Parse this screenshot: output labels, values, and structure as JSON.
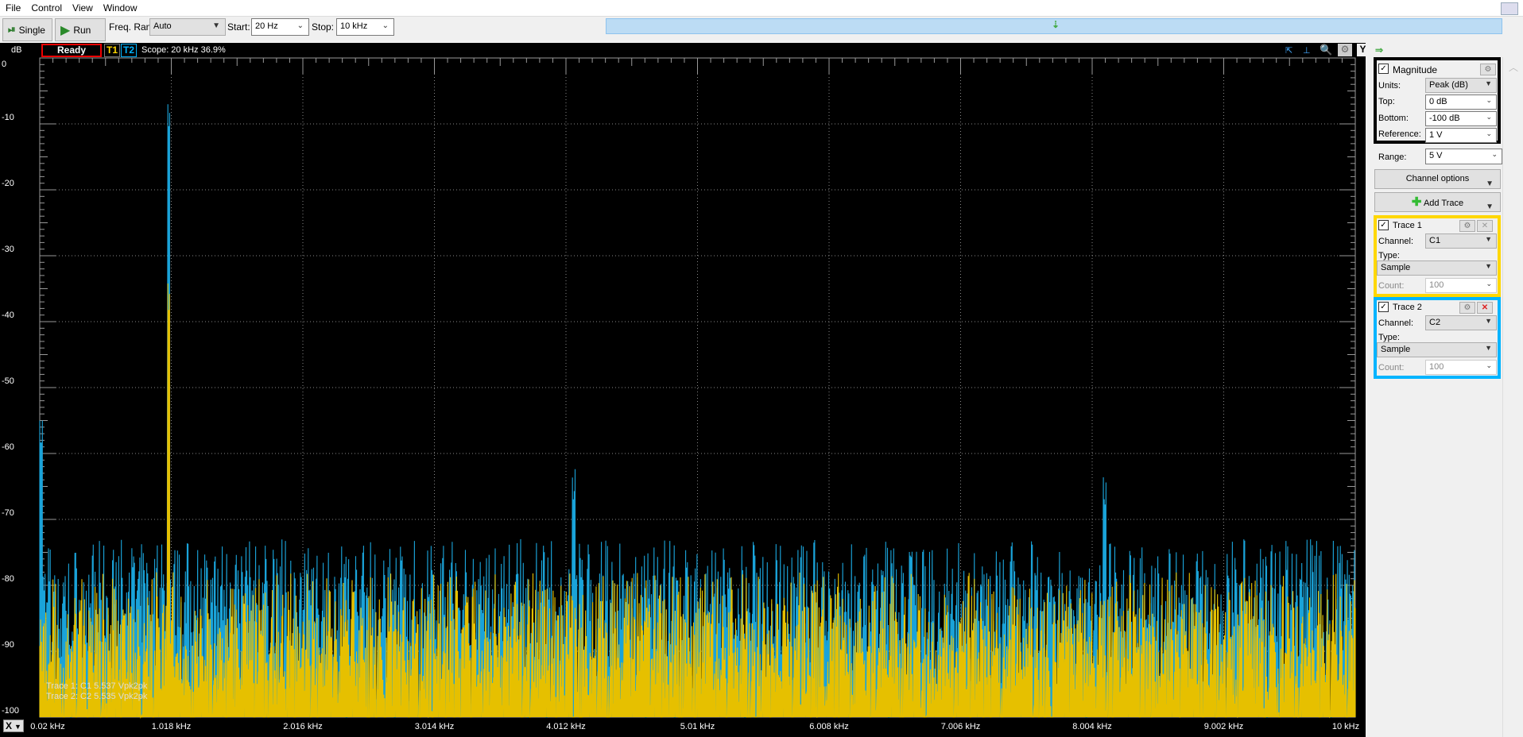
{
  "menu": [
    "File",
    "Control",
    "View",
    "Window"
  ],
  "toolbar": {
    "single_label": "Single",
    "run_label": "Run",
    "freq_range_label": "Freq. Range:",
    "freq_range_value": "Auto",
    "start_label": "Start:",
    "start_value": "20 Hz",
    "stop_label": "Stop:",
    "stop_value": "10 kHz"
  },
  "plot_header": {
    "status": "Ready",
    "t1": "T1",
    "t2": "T2",
    "scope": "Scope: 20 kHz 36.9%",
    "y_unit": "dB",
    "y_button": "Y",
    "x_button": "X"
  },
  "y_ticks": [
    "0",
    "-10",
    "-20",
    "-30",
    "-40",
    "-50",
    "-60",
    "-70",
    "-80",
    "-90",
    "-100"
  ],
  "x_ticks": [
    "0.02 kHz",
    "1.018 kHz",
    "2.016 kHz",
    "3.014 kHz",
    "4.012 kHz",
    "5.01 kHz",
    "6.008 kHz",
    "7.006 kHz",
    "8.004 kHz",
    "9.002 kHz",
    "10 kHz"
  ],
  "readouts": [
    "Trace 1: C1 5.537 Vpk2pk",
    "Trace 2: C2 5.535 Vpk2pk"
  ],
  "magnitude": {
    "title": "Magnitude",
    "units_label": "Units:",
    "units": "Peak (dB)",
    "top_label": "Top:",
    "top": "0 dB",
    "bottom_label": "Bottom:",
    "bottom": "-100 dB",
    "reference_label": "Reference:",
    "reference": "1 V"
  },
  "range": {
    "label": "Range:",
    "value": "5 V"
  },
  "channel_options": "Channel options",
  "add_trace": "Add Trace",
  "traces": [
    {
      "title": "Trace 1",
      "channel_label": "Channel:",
      "channel": "C1",
      "type_label": "Type:",
      "type": "Sample",
      "count_label": "Count:",
      "count": "100",
      "color": "#ffd700"
    },
    {
      "title": "Trace 2",
      "channel_label": "Channel:",
      "channel": "C2",
      "type_label": "Type:",
      "type": "Sample",
      "count_label": "Count:",
      "count": "100",
      "color": "#00b4ff"
    }
  ],
  "chart_data": {
    "type": "line",
    "xlabel": "",
    "ylabel": "dB",
    "xlim_khz": [
      0.02,
      10
    ],
    "ylim": [
      -100,
      0
    ],
    "grid": true,
    "series": [
      {
        "name": "T1",
        "color": "#e6c000",
        "noise_floor_db": -87,
        "peaks": [
          {
            "khz": 1.0,
            "db": -39
          }
        ]
      },
      {
        "name": "T2",
        "color": "#1aa3d9",
        "noise_floor_db": -82,
        "peaks": [
          {
            "khz": 0.03,
            "db": -60
          },
          {
            "khz": 1.0,
            "db": -11
          },
          {
            "khz": 4.07,
            "db": -68
          },
          {
            "khz": 8.1,
            "db": -69
          }
        ]
      }
    ]
  }
}
